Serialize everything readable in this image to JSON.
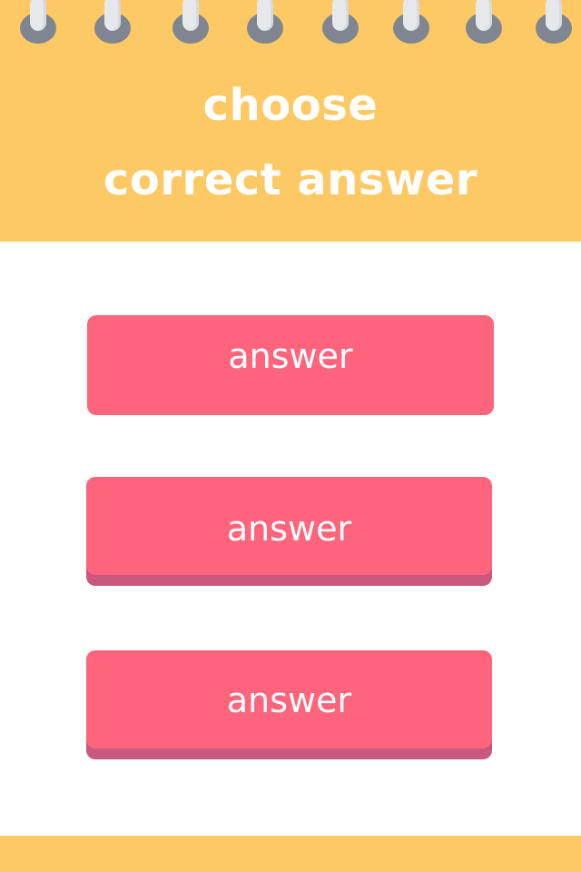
{
  "header": {
    "title_line1": "choose",
    "title_line2": "correct answer",
    "ring_icon": "spiral-ring"
  },
  "answers": [
    {
      "label": "answer"
    },
    {
      "label": "answer"
    },
    {
      "label": "answer"
    }
  ],
  "colors": {
    "header_bg": "#fdc964",
    "button_bg": "#fe647c",
    "button_shadow": "#c9587f",
    "ring_hole": "#7f8691",
    "ring_wire": "#e6e8ec",
    "text": "#ffffff"
  }
}
